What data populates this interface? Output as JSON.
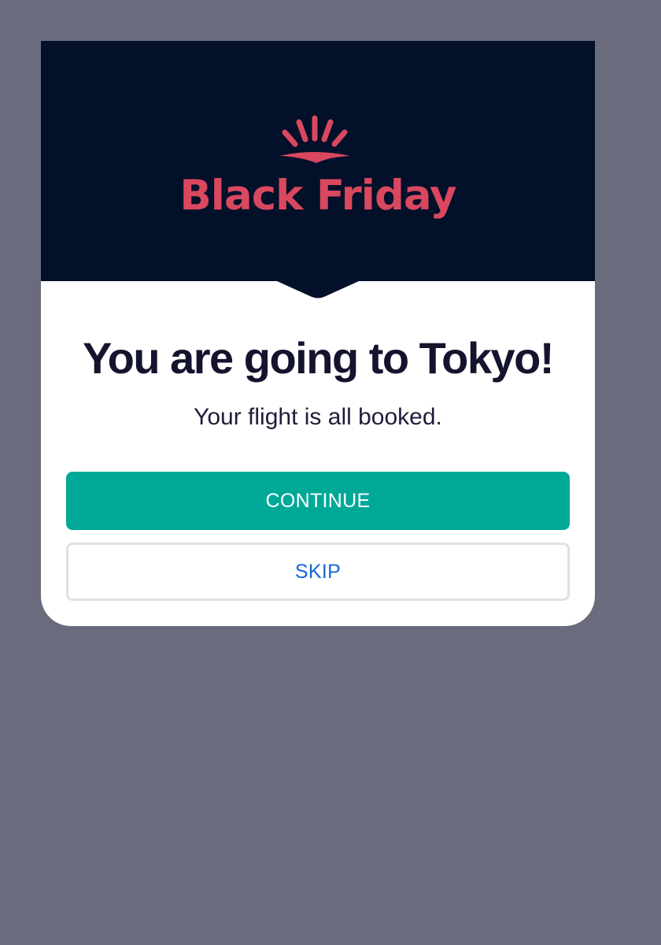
{
  "brand": {
    "name": "Black Friday",
    "logo_icon": "sunrise-icon"
  },
  "dialog": {
    "title": "You are going to Tokyo!",
    "message": "Your flight is all booked."
  },
  "actions": {
    "continue_label": "CONTINUE",
    "skip_label": "SKIP"
  },
  "colors": {
    "backdrop": "#6b6b7e",
    "banner": "#02102a",
    "brand_accent": "#d9485f",
    "primary_button": "#00a898",
    "skip_text": "#1565d8",
    "title_text": "#14142e"
  }
}
